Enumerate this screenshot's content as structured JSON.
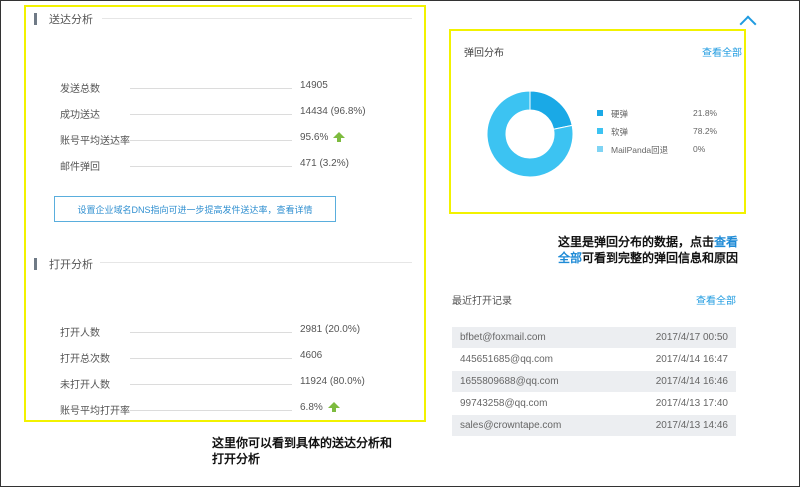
{
  "delivery_section": {
    "title": "送达分析",
    "rows": [
      {
        "label": "发送总数",
        "value": "14905",
        "trend": null
      },
      {
        "label": "成功送达",
        "value": "14434 (96.8%)",
        "trend": null
      },
      {
        "label": "账号平均送达率",
        "value": "95.6%",
        "trend": "up"
      },
      {
        "label": "邮件弹回",
        "value": "471 (3.2%)",
        "trend": null
      }
    ],
    "dns_button_label": "设置企业域名DNS指向可进一步提高发件送达率，查看详情"
  },
  "open_section": {
    "title": "打开分析",
    "rows": [
      {
        "label": "打开人数",
        "value": "2981 (20.0%)",
        "trend": null
      },
      {
        "label": "打开总次数",
        "value": "4606",
        "trend": null
      },
      {
        "label": "未打开人数",
        "value": "11924 (80.0%)",
        "trend": null
      },
      {
        "label": "账号平均打开率",
        "value": "6.8%",
        "trend": "up"
      }
    ]
  },
  "bounce_panel": {
    "title": "弹回分布",
    "view_all": "查看全部",
    "chart_data": {
      "type": "pie",
      "categories": [
        "硬弹",
        "软弹",
        "MailPanda回退"
      ],
      "values": [
        21.8,
        78.2,
        0
      ],
      "value_labels": [
        "21.8%",
        "78.2%",
        "0%"
      ],
      "colors": [
        "#1aa9e6",
        "#3cc3f2",
        "#7fd4f4"
      ]
    }
  },
  "recent_opens": {
    "title": "最近打开记录",
    "view_all": "查看全部",
    "rows": [
      {
        "email": "bfbet@foxmail.com",
        "time": "2017/4/17 00:50"
      },
      {
        "email": "445651685@qq.com",
        "time": "2017/4/14 16:47"
      },
      {
        "email": "1655809688@qq.com",
        "time": "2017/4/14 16:46"
      },
      {
        "email": "99743258@qq.com",
        "time": "2017/4/13 17:40"
      },
      {
        "email": "sales@crowntape.com",
        "time": "2017/4/13 14:46"
      }
    ]
  },
  "annotations": {
    "bounce_note_line1_pre": "这里是弹回分布的数据，点击",
    "bounce_note_line1_hl": "查看",
    "bounce_note_line2_hl": "全部",
    "bounce_note_line2_post": "可看到完整的弹回信息和原因",
    "left_note_line1": "这里你可以看到具体的送达分析和",
    "left_note_line2": "打开分析"
  },
  "colors": {
    "accent": "#1f9be0",
    "highlight_box": "#f2f200",
    "trend_up": "#7dbb3f"
  }
}
